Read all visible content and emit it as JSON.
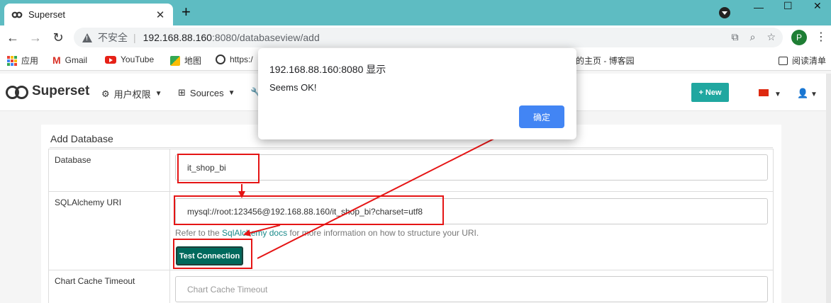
{
  "browser": {
    "tab_title": "Superset",
    "new_tab_symbol": "+",
    "close_tab_symbol": "✕",
    "url_warning": "不安全",
    "url_host": "192.168.88.160",
    "url_path": ":8080/databaseview/add",
    "profile_initial": "P"
  },
  "bookmarks": {
    "apps": "应用",
    "gmail": "Gmail",
    "youtube": "YouTube",
    "maps": "地图",
    "https": "https:/",
    "blog": "的主页 - 博客园",
    "reading_list": "阅读清单"
  },
  "navbar": {
    "brand": "Superset",
    "menu_security": "用户权限",
    "menu_sources": "Sources",
    "new_button": "New"
  },
  "form": {
    "title": "Add Database",
    "database_label": "Database",
    "database_value": "it_shop_bi",
    "uri_label": "SQLAlchemy URI",
    "uri_value": "mysql://root:123456@192.168.88.160/it_shop_bi?charset=utf8",
    "help_prefix": "Refer to the ",
    "help_link": "SqlAlchemy docs",
    "help_suffix": " for more information on how to structure your URI.",
    "test_button": "Test Connection",
    "cache_label": "Chart Cache Timeout",
    "cache_placeholder": "Chart Cache Timeout"
  },
  "dialog": {
    "title": "192.168.88.160:8080 显示",
    "message": "Seems OK!",
    "ok_button": "确定"
  },
  "colors": {
    "tabstrip": "#5ebcc2",
    "brand_accent": "#20a7a0",
    "test_button": "#00695c",
    "annotation": "#e51515",
    "dialog_button": "#4285f4"
  }
}
